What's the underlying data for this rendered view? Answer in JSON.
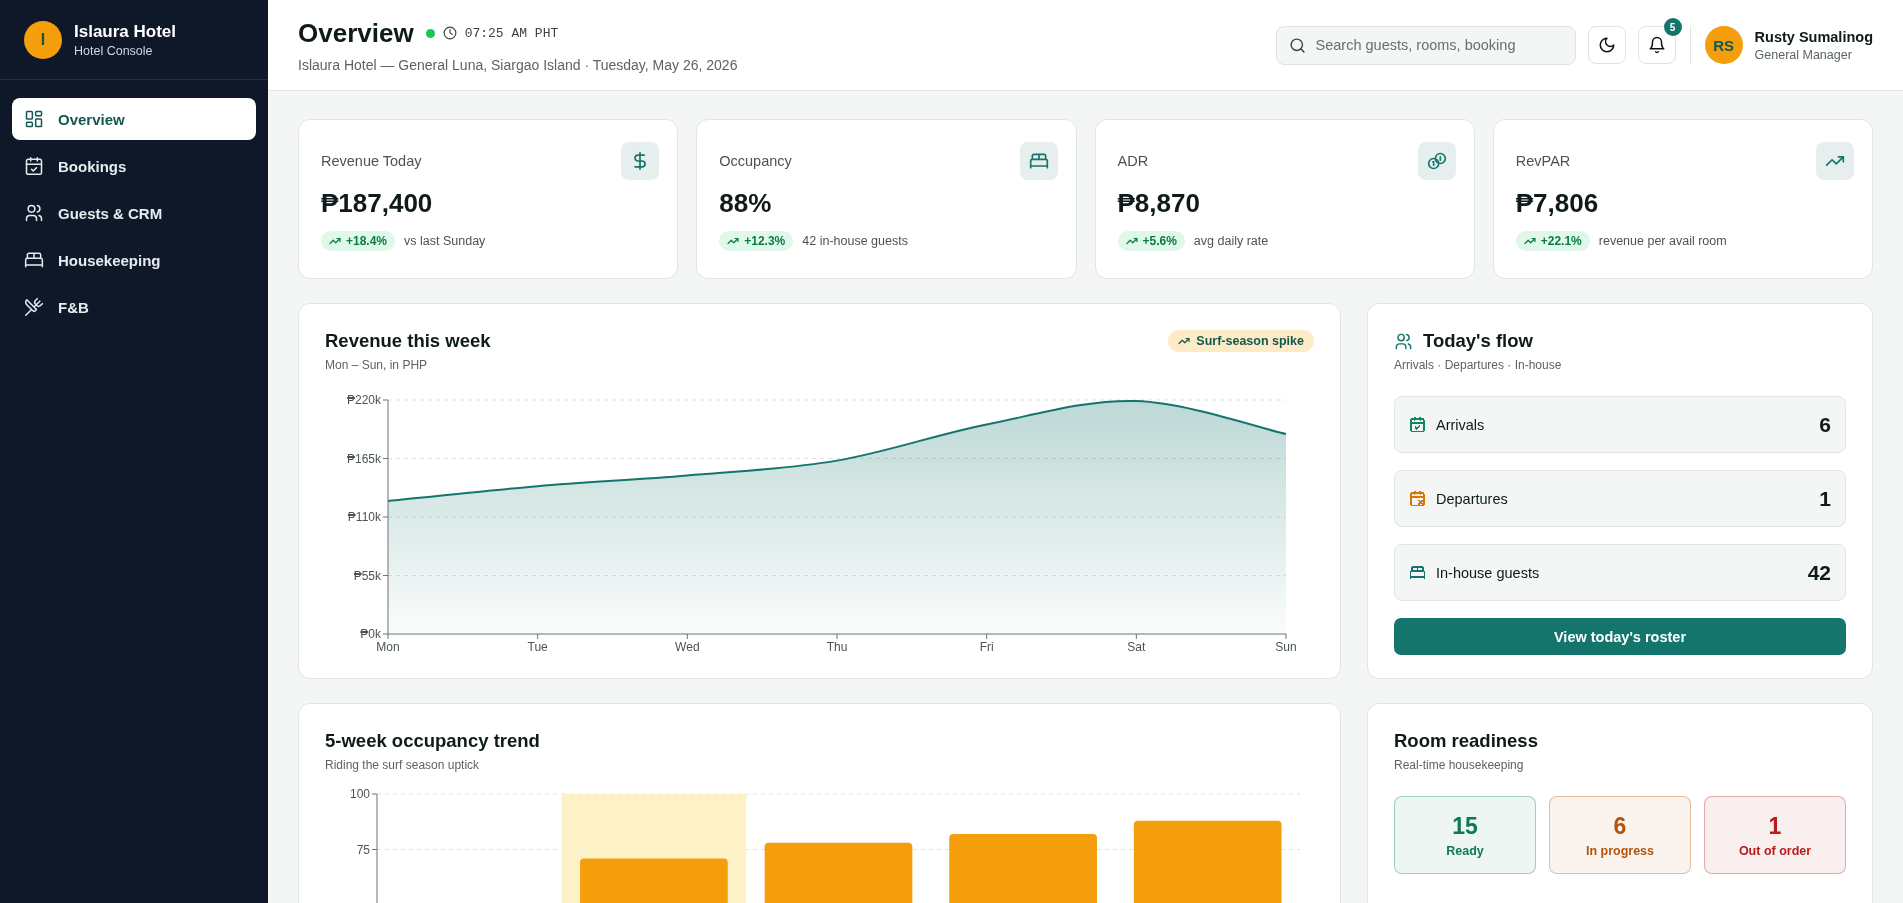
{
  "sidebar": {
    "brand": {
      "initial": "I",
      "name": "Islaura Hotel",
      "subtitle": "Hotel Console"
    },
    "items": [
      {
        "label": "Overview",
        "selected": true
      },
      {
        "label": "Bookings",
        "selected": false
      },
      {
        "label": "Guests & CRM",
        "selected": false
      },
      {
        "label": "Housekeeping",
        "selected": false
      },
      {
        "label": "F&B",
        "selected": false
      }
    ]
  },
  "header": {
    "title": "Overview",
    "live": true,
    "time": "07:25 AM PHT",
    "subtitle": "Islaura Hotel — General Luna, Siargao Island · Tuesday, May 26, 2026",
    "search": {
      "placeholder": "Search guests, rooms, booking"
    },
    "notifications": "5",
    "user": {
      "initials": "RS",
      "name": "Rusty Sumalinog",
      "role": "General Manager"
    }
  },
  "kpis": [
    {
      "label": "Revenue Today",
      "value": "₱187,400",
      "delta": "+18.4%",
      "note": "vs last Sunday"
    },
    {
      "label": "Occupancy",
      "value": "88%",
      "delta": "+12.3%",
      "note": "42 in-house guests"
    },
    {
      "label": "ADR",
      "value": "₱8,870",
      "delta": "+5.6%",
      "note": "avg daily rate"
    },
    {
      "label": "RevPAR",
      "value": "₱7,806",
      "delta": "+22.1%",
      "note": "revenue per avail room"
    }
  ],
  "revenue": {
    "title": "Revenue this week",
    "subtitle": "Mon – Sun, in PHP",
    "badge": "Surf-season spike",
    "chart_data": {
      "type": "area",
      "categories": [
        "Mon",
        "Tue",
        "Wed",
        "Thu",
        "Fri",
        "Sat",
        "Sun"
      ],
      "grid": true,
      "series": [
        {
          "color": "#13756b",
          "values": [
            125000,
            139000,
            149000,
            163000,
            197000,
            219000,
            188000
          ]
        }
      ],
      "ylim": [
        0,
        220000
      ],
      "yticks": [
        {
          "value": 0,
          "label": "₱0k"
        },
        {
          "value": 55000,
          "label": "₱55k"
        },
        {
          "value": 110000,
          "label": "₱110k"
        },
        {
          "value": 165000,
          "label": "₱165k"
        },
        {
          "value": 220000,
          "label": "₱220k"
        }
      ]
    }
  },
  "flow": {
    "title": "Today's flow",
    "subtitle": "Arrivals · Departures · In-house",
    "items": [
      {
        "label": "Arrivals",
        "value": "6",
        "color": "#0f8a5f"
      },
      {
        "label": "Departures",
        "value": "1",
        "color": "#d97706"
      },
      {
        "label": "In-house guests",
        "value": "42",
        "color": "#13756b"
      }
    ],
    "button": "View today's roster"
  },
  "occupancy": {
    "title": "5-week occupancy trend",
    "subtitle": "Riding the surf season uptick",
    "chart_data": {
      "type": "bar",
      "grid": true,
      "series": [
        {
          "color": "#fdf1c7",
          "values": [
            null,
            100,
            null,
            null,
            null
          ]
        },
        {
          "color": "#f59e0b",
          "values": [
            null,
            71,
            78,
            82,
            88
          ]
        }
      ],
      "ylim": [
        0,
        100
      ],
      "yticks": [
        75,
        100
      ]
    }
  },
  "readiness": {
    "title": "Room readiness",
    "subtitle": "Real-time housekeeping",
    "tiles": [
      {
        "value": "15",
        "label": "Ready",
        "color": "#0b7a55"
      },
      {
        "value": "6",
        "label": "In progress",
        "color": "#b45309"
      },
      {
        "value": "1",
        "label": "Out of order",
        "color": "#b91c1c"
      }
    ]
  }
}
